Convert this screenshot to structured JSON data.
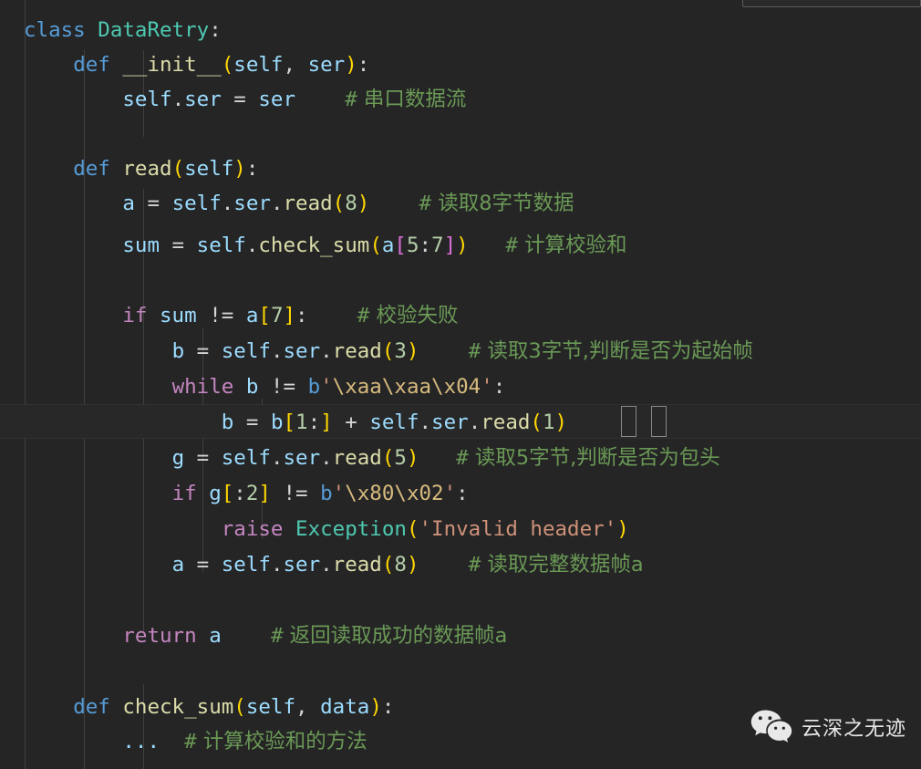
{
  "editor": {
    "background_color": "#252526",
    "active_line_color": "#282828",
    "indent_guide_color": "#404040",
    "font_size_px": 22,
    "language": "python",
    "colors": {
      "keyword": "#569CD6",
      "control": "#C586C0",
      "class": "#4EC9B0",
      "function": "#DCDCAA",
      "variable": "#9CDCFE",
      "number": "#B5CEA8",
      "string": "#CE9178",
      "escape": "#D7BA7D",
      "comment": "#6A9955",
      "bracket1": "#FFD700",
      "bracket2": "#DA70D6",
      "bracket3": "#179FFF",
      "plain": "#D4D4D4"
    },
    "cursor_line_number": 11,
    "bracket_match_pair": [
      "(",
      ")"
    ]
  },
  "code": {
    "plain_text": "class DataRetry:\n    def __init__(self, ser):\n        self.ser = ser    # 串口数据流\n\n    def read(self):\n        a = self.ser.read(8)    # 读取8字节数据\n        sum = self.check_sum(a[5:7])   # 计算校验和\n\n        if sum != a[7]:    # 校验失败\n            b = self.ser.read(3)    # 读取3字节,判断是否为起始帧\n            while b != b'\\xaa\\xaa\\x04':\n                b = b[1:] + self.ser.read(1)\n            g = self.ser.read(5)   # 读取5字节,判断是否为包头\n            if g[:2] != b'\\x80\\x02':\n                raise Exception('Invalid header')\n            a = self.ser.read(8)    # 读取完整数据帧a\n\n        return a    # 返回读取成功的数据帧a\n\n    def check_sum(self, data):\n        ...  # 计算校验和的方法",
    "lines": [
      {
        "n": 1,
        "text": "class DataRetry:"
      },
      {
        "n": 2,
        "text": "    def __init__(self, ser):"
      },
      {
        "n": 3,
        "text": "        self.ser = ser    # 串口数据流"
      },
      {
        "n": 4,
        "text": ""
      },
      {
        "n": 5,
        "text": "    def read(self):"
      },
      {
        "n": 6,
        "text": "        a = self.ser.read(8)    # 读取8字节数据"
      },
      {
        "n": 7,
        "text": "        sum = self.check_sum(a[5:7])   # 计算校验和"
      },
      {
        "n": 8,
        "text": ""
      },
      {
        "n": 9,
        "text": "        if sum != a[7]:    # 校验失败"
      },
      {
        "n": 10,
        "text": "            b = self.ser.read(3)    # 读取3字节,判断是否为起始帧"
      },
      {
        "n": 11,
        "text": "            while b != b'\\xaa\\xaa\\x04':"
      },
      {
        "n": 12,
        "text": "                b = b[1:] + self.ser.read(1)"
      },
      {
        "n": 13,
        "text": "            g = self.ser.read(5)   # 读取5字节,判断是否为包头"
      },
      {
        "n": 14,
        "text": "            if g[:2] != b'\\x80\\x02':"
      },
      {
        "n": 15,
        "text": "                raise Exception('Invalid header')"
      },
      {
        "n": 16,
        "text": "            a = self.ser.read(8)    # 读取完整数据帧a"
      },
      {
        "n": 17,
        "text": ""
      },
      {
        "n": 18,
        "text": "        return a    # 返回读取成功的数据帧a"
      },
      {
        "n": 19,
        "text": ""
      },
      {
        "n": 20,
        "text": "    def check_sum(self, data):"
      },
      {
        "n": 21,
        "text": "        ...  # 计算校验和的方法"
      }
    ],
    "comments": [
      "# 串口数据流",
      "# 读取8字节数据",
      "# 计算校验和",
      "# 校验失败",
      "# 读取3字节,判断是否为起始帧",
      "# 读取5字节,判断是否为包头",
      "# 读取完整数据帧a",
      "# 返回读取成功的数据帧a",
      "# 计算校验和的方法"
    ],
    "identifiers": {
      "class_name": "DataRetry",
      "methods": [
        "__init__",
        "read",
        "check_sum"
      ],
      "attributes": [
        "self.ser"
      ],
      "locals": [
        "a",
        "sum",
        "b",
        "g",
        "ser",
        "data"
      ],
      "byte_literals": [
        "b'\\xaa\\xaa\\x04'",
        "b'\\x80\\x02'"
      ],
      "strings": [
        "'Invalid header'"
      ],
      "numbers": [
        "8",
        "5",
        "7",
        "3",
        "1",
        "2"
      ],
      "exception": "Exception"
    }
  },
  "watermark": {
    "text": "云深之无迹",
    "icon": "wechat-icon",
    "color": "#e8e8e8"
  }
}
